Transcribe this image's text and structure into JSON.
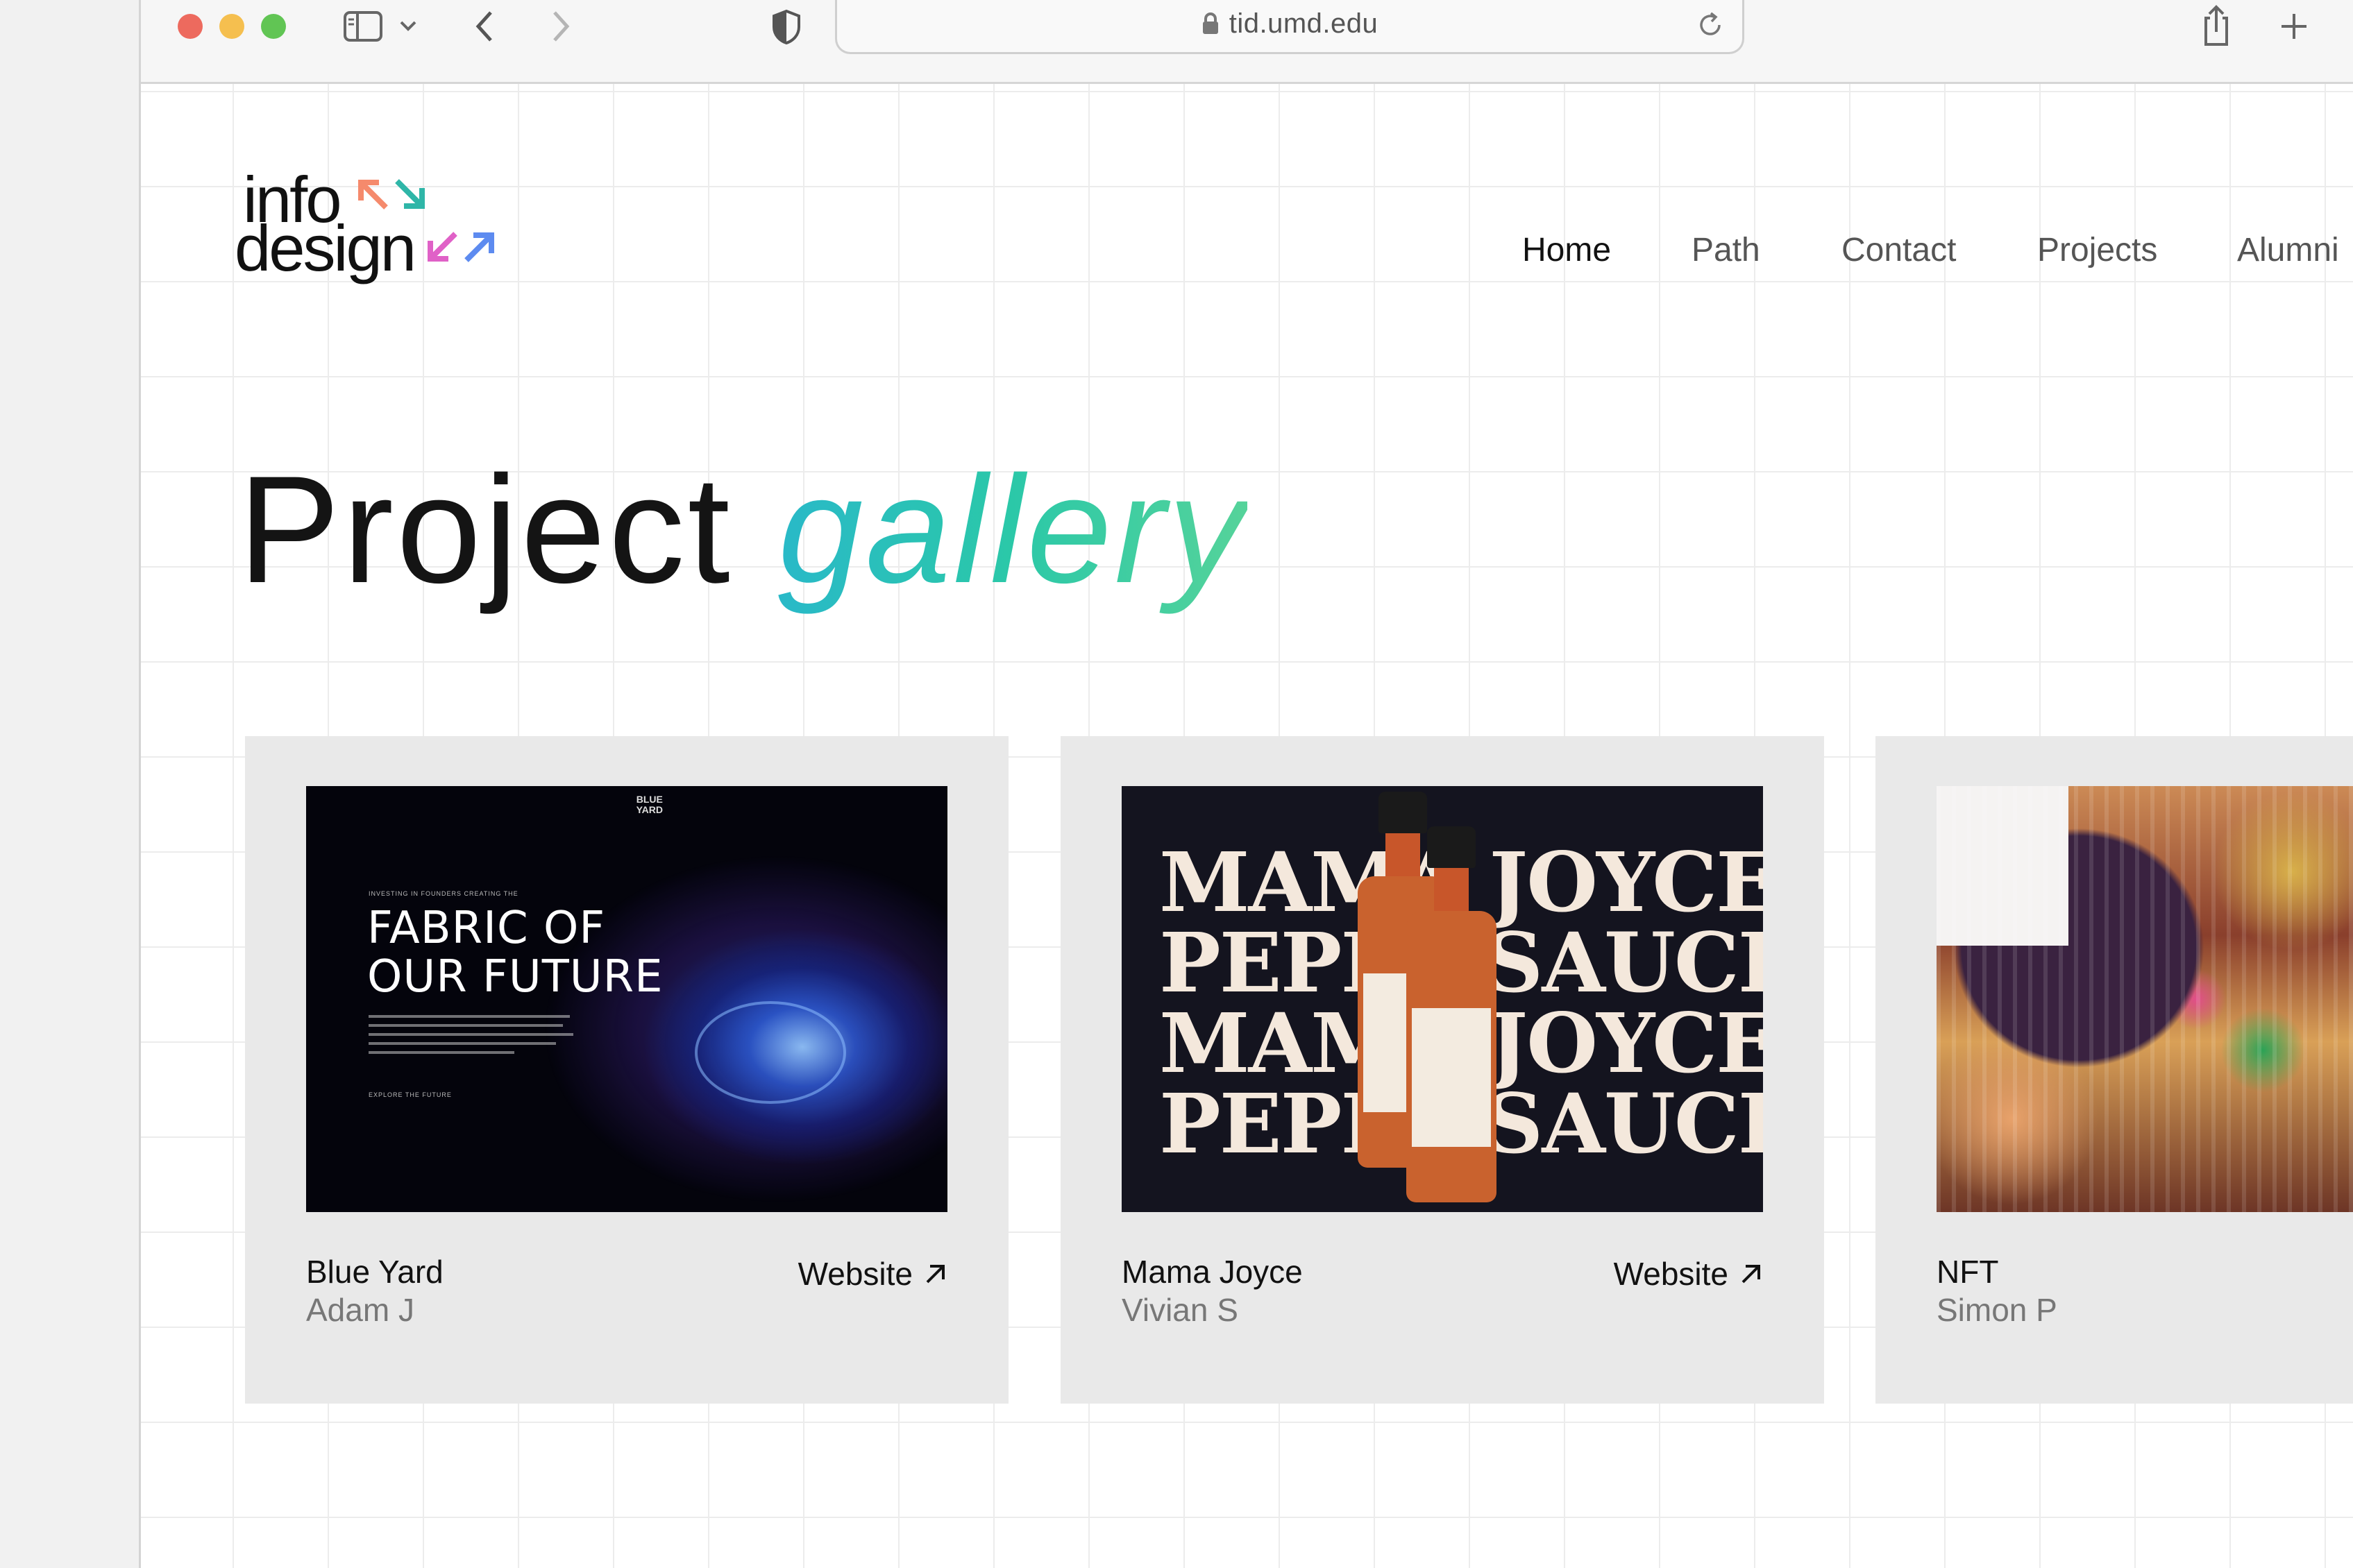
{
  "browser": {
    "url": "tid.umd.edu",
    "traffic_lights": [
      "#ed6a5e",
      "#f5bf4f",
      "#61c554"
    ]
  },
  "logo": {
    "line1": "info",
    "line2": "design",
    "arrow_colors": [
      "#f58a6c",
      "#2fb6a8",
      "#e061c7",
      "#5d8bf0"
    ]
  },
  "nav": {
    "items": [
      {
        "label": "Home",
        "active": true
      },
      {
        "label": "Path",
        "active": false
      },
      {
        "label": "Contact",
        "active": false
      },
      {
        "label": "Projects",
        "active": false
      },
      {
        "label": "Alumni",
        "active": false
      }
    ]
  },
  "hero": {
    "word1": "Project",
    "word2": "gallery"
  },
  "projects": [
    {
      "title": "Blue Yard",
      "author": "Adam J",
      "link_label": "Website",
      "thumb": {
        "brand": "BLUE\nYARD",
        "kicker": "INVESTING IN FOUNDERS CREATING THE",
        "headline": "FABRIC OF\nOUR FUTURE",
        "cta": "EXPLORE THE FUTURE"
      }
    },
    {
      "title": "Mama Joyce",
      "author": "Vivian S",
      "link_label": "Website",
      "thumb": {
        "lines": [
          "MAMA JOYCE",
          "PEPPA SAUCE",
          "MAMA JOYCE",
          "PEPPA SAUCE"
        ]
      }
    },
    {
      "title": "NFT",
      "author": "Simon P",
      "link_label": ""
    }
  ]
}
